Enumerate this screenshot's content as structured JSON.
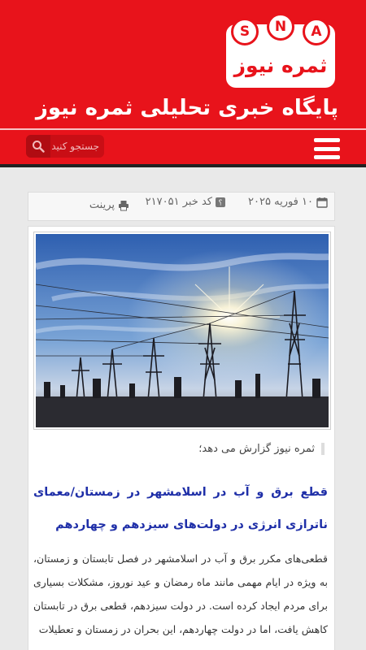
{
  "header": {
    "logo_letters": [
      "S",
      "N",
      "A"
    ],
    "logo_text": "ثمره نیوز",
    "site_title": "پایگاه خبری تحلیلی ثمره نیوز"
  },
  "nav": {
    "search_placeholder": "جستجو کنید"
  },
  "meta": {
    "date": "۱۰ فوریه ۲۰۲۵",
    "news_code": "کد خبر ۲۱۷۰۵۱",
    "print": "پرینت"
  },
  "article": {
    "lead": "ثمره نیوز گزارش می دهد؛",
    "headline": "قطع برق و آب در اسلامشهر در زمستان/معمای ناترازی انرژی در دولت‌های سیزدهم و چهاردهم",
    "body": "قطعی‌های مکرر برق و آب در اسلامشهر در فصل تابستان و زمستان، به ویژه در ایام مهمی مانند ماه رمضان و عید نوروز، مشکلات بسیاری برای مردم ایجاد کرده است. در دولت سیزدهم، قطعی برق در تابستان کاهش یافت، اما در دولت چهاردهم، این بحران در زمستان و تعطیلات"
  },
  "colors": {
    "brand_red": "#e8131b",
    "headline_blue": "#1f2fa8"
  }
}
